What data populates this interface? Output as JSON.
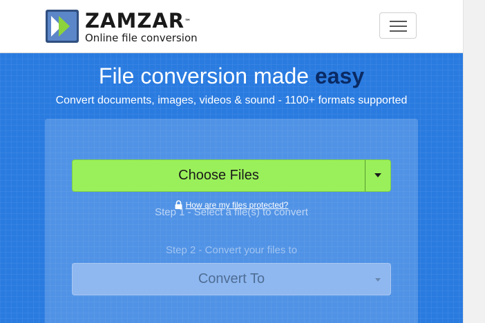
{
  "navbar": {
    "brand_name": "ZAMZAR",
    "brand_tm": "™",
    "tagline": "Online file conversion",
    "menu_icon": "hamburger-menu-icon"
  },
  "hero": {
    "title_main": "File conversion made ",
    "title_accent": "easy",
    "subtitle": "Convert documents, images, videos & sound - 1100+ formats supported"
  },
  "converter": {
    "step1_label": "Step 1 - Select a file(s) to convert",
    "choose_files_label": "Choose Files",
    "protect_link_text": "How are my files protected?",
    "step2_label": "Step 2 - Convert your files to",
    "convert_to_label": "Convert To"
  },
  "colors": {
    "hero_background": "#2a7be0",
    "accent_text": "#0a2a63",
    "choose_button": "#9af05a",
    "convert_select": "#8fb8f0"
  }
}
